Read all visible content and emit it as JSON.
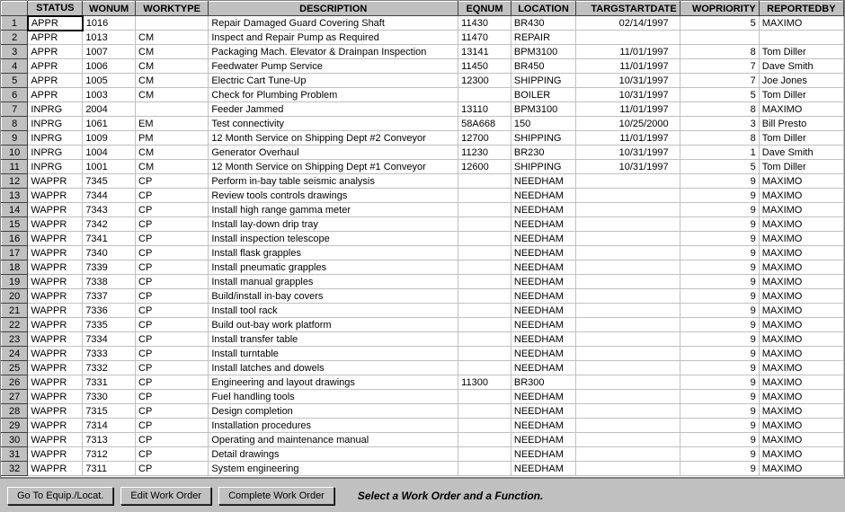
{
  "columns": [
    "STATUS",
    "WONUM",
    "WORKTYPE",
    "DESCRIPTION",
    "EQNUM",
    "LOCATION",
    "TARGSTARTDATE",
    "WOPRIORITY",
    "REPORTEDBY"
  ],
  "rows": [
    {
      "n": 1,
      "status": "APPR",
      "wonum": "1016",
      "worktype": "",
      "desc": "Repair Damaged Guard Covering Shaft",
      "eqnum": "11430",
      "location": "BR430",
      "targstart": "02/14/1997",
      "wopri": "5",
      "repby": "MAXIMO"
    },
    {
      "n": 2,
      "status": "APPR",
      "wonum": "1013",
      "worktype": "CM",
      "desc": "Inspect and Repair Pump as Required",
      "eqnum": "11470",
      "location": "REPAIR",
      "targstart": "",
      "wopri": "",
      "repby": ""
    },
    {
      "n": 3,
      "status": "APPR",
      "wonum": "1007",
      "worktype": "CM",
      "desc": "Packaging Mach. Elevator & Drainpan Inspection",
      "eqnum": "13141",
      "location": "BPM3100",
      "targstart": "11/01/1997",
      "wopri": "8",
      "repby": "Tom Diller"
    },
    {
      "n": 4,
      "status": "APPR",
      "wonum": "1006",
      "worktype": "CM",
      "desc": "Feedwater Pump Service",
      "eqnum": "11450",
      "location": "BR450",
      "targstart": "11/01/1997",
      "wopri": "7",
      "repby": "Dave Smith"
    },
    {
      "n": 5,
      "status": "APPR",
      "wonum": "1005",
      "worktype": "CM",
      "desc": "Electric Cart Tune-Up",
      "eqnum": "12300",
      "location": "SHIPPING",
      "targstart": "10/31/1997",
      "wopri": "7",
      "repby": "Joe Jones"
    },
    {
      "n": 6,
      "status": "APPR",
      "wonum": "1003",
      "worktype": "CM",
      "desc": "Check for Plumbing Problem",
      "eqnum": "",
      "location": "BOILER",
      "targstart": "10/31/1997",
      "wopri": "5",
      "repby": "Tom Diller"
    },
    {
      "n": 7,
      "status": "INPRG",
      "wonum": "2004",
      "worktype": "",
      "desc": "Feeder Jammed",
      "eqnum": "13110",
      "location": "BPM3100",
      "targstart": "11/01/1997",
      "wopri": "8",
      "repby": "MAXIMO"
    },
    {
      "n": 8,
      "status": "INPRG",
      "wonum": "1061",
      "worktype": "EM",
      "desc": "Test connectivity",
      "eqnum": "58A668",
      "location": "150",
      "targstart": "10/25/2000",
      "wopri": "3",
      "repby": "Bill Presto"
    },
    {
      "n": 9,
      "status": "INPRG",
      "wonum": "1009",
      "worktype": "PM",
      "desc": "12 Month Service on Shipping Dept #2 Conveyor",
      "eqnum": "12700",
      "location": "SHIPPING",
      "targstart": "11/01/1997",
      "wopri": "8",
      "repby": "Tom Diller"
    },
    {
      "n": 10,
      "status": "INPRG",
      "wonum": "1004",
      "worktype": "CM",
      "desc": "Generator Overhaul",
      "eqnum": "11230",
      "location": "BR230",
      "targstart": "10/31/1997",
      "wopri": "1",
      "repby": "Dave Smith"
    },
    {
      "n": 11,
      "status": "INPRG",
      "wonum": "1001",
      "worktype": "CM",
      "desc": "12 Month Service on Shipping Dept #1 Conveyor",
      "eqnum": "12600",
      "location": "SHIPPING",
      "targstart": "10/31/1997",
      "wopri": "5",
      "repby": "Tom Diller"
    },
    {
      "n": 12,
      "status": "WAPPR",
      "wonum": "7345",
      "worktype": "CP",
      "desc": "Perform in-bay table seismic analysis",
      "eqnum": "",
      "location": "NEEDHAM",
      "targstart": "",
      "wopri": "9",
      "repby": "MAXIMO"
    },
    {
      "n": 13,
      "status": "WAPPR",
      "wonum": "7344",
      "worktype": "CP",
      "desc": "Review tools controls drawings",
      "eqnum": "",
      "location": "NEEDHAM",
      "targstart": "",
      "wopri": "9",
      "repby": "MAXIMO"
    },
    {
      "n": 14,
      "status": "WAPPR",
      "wonum": "7343",
      "worktype": "CP",
      "desc": "Install high range gamma meter",
      "eqnum": "",
      "location": "NEEDHAM",
      "targstart": "",
      "wopri": "9",
      "repby": "MAXIMO"
    },
    {
      "n": 15,
      "status": "WAPPR",
      "wonum": "7342",
      "worktype": "CP",
      "desc": "Install lay-down drip tray",
      "eqnum": "",
      "location": "NEEDHAM",
      "targstart": "",
      "wopri": "9",
      "repby": "MAXIMO"
    },
    {
      "n": 16,
      "status": "WAPPR",
      "wonum": "7341",
      "worktype": "CP",
      "desc": "Install inspection telescope",
      "eqnum": "",
      "location": "NEEDHAM",
      "targstart": "",
      "wopri": "9",
      "repby": "MAXIMO"
    },
    {
      "n": 17,
      "status": "WAPPR",
      "wonum": "7340",
      "worktype": "CP",
      "desc": "Install flask grapples",
      "eqnum": "",
      "location": "NEEDHAM",
      "targstart": "",
      "wopri": "9",
      "repby": "MAXIMO"
    },
    {
      "n": 18,
      "status": "WAPPR",
      "wonum": "7339",
      "worktype": "CP",
      "desc": "Install pneumatic grapples",
      "eqnum": "",
      "location": "NEEDHAM",
      "targstart": "",
      "wopri": "9",
      "repby": "MAXIMO"
    },
    {
      "n": 19,
      "status": "WAPPR",
      "wonum": "7338",
      "worktype": "CP",
      "desc": "Install manual grapples",
      "eqnum": "",
      "location": "NEEDHAM",
      "targstart": "",
      "wopri": "9",
      "repby": "MAXIMO"
    },
    {
      "n": 20,
      "status": "WAPPR",
      "wonum": "7337",
      "worktype": "CP",
      "desc": "Build/install in-bay covers",
      "eqnum": "",
      "location": "NEEDHAM",
      "targstart": "",
      "wopri": "9",
      "repby": "MAXIMO"
    },
    {
      "n": 21,
      "status": "WAPPR",
      "wonum": "7336",
      "worktype": "CP",
      "desc": "Install tool rack",
      "eqnum": "",
      "location": "NEEDHAM",
      "targstart": "",
      "wopri": "9",
      "repby": "MAXIMO"
    },
    {
      "n": 22,
      "status": "WAPPR",
      "wonum": "7335",
      "worktype": "CP",
      "desc": "Build out-bay work platform",
      "eqnum": "",
      "location": "NEEDHAM",
      "targstart": "",
      "wopri": "9",
      "repby": "MAXIMO"
    },
    {
      "n": 23,
      "status": "WAPPR",
      "wonum": "7334",
      "worktype": "CP",
      "desc": "Install transfer table",
      "eqnum": "",
      "location": "NEEDHAM",
      "targstart": "",
      "wopri": "9",
      "repby": "MAXIMO"
    },
    {
      "n": 24,
      "status": "WAPPR",
      "wonum": "7333",
      "worktype": "CP",
      "desc": "Install turntable",
      "eqnum": "",
      "location": "NEEDHAM",
      "targstart": "",
      "wopri": "9",
      "repby": "MAXIMO"
    },
    {
      "n": 25,
      "status": "WAPPR",
      "wonum": "7332",
      "worktype": "CP",
      "desc": "Install latches and dowels",
      "eqnum": "",
      "location": "NEEDHAM",
      "targstart": "",
      "wopri": "9",
      "repby": "MAXIMO"
    },
    {
      "n": 26,
      "status": "WAPPR",
      "wonum": "7331",
      "worktype": "CP",
      "desc": "Engineering and layout drawings",
      "eqnum": "11300",
      "location": "BR300",
      "targstart": "",
      "wopri": "9",
      "repby": "MAXIMO"
    },
    {
      "n": 27,
      "status": "WAPPR",
      "wonum": "7330",
      "worktype": "CP",
      "desc": "Fuel handling tools",
      "eqnum": "",
      "location": "NEEDHAM",
      "targstart": "",
      "wopri": "9",
      "repby": "MAXIMO"
    },
    {
      "n": 28,
      "status": "WAPPR",
      "wonum": "7315",
      "worktype": "CP",
      "desc": "Design completion",
      "eqnum": "",
      "location": "NEEDHAM",
      "targstart": "",
      "wopri": "9",
      "repby": "MAXIMO"
    },
    {
      "n": 29,
      "status": "WAPPR",
      "wonum": "7314",
      "worktype": "CP",
      "desc": "Installation procedures",
      "eqnum": "",
      "location": "NEEDHAM",
      "targstart": "",
      "wopri": "9",
      "repby": "MAXIMO"
    },
    {
      "n": 30,
      "status": "WAPPR",
      "wonum": "7313",
      "worktype": "CP",
      "desc": "Operating and maintenance manual",
      "eqnum": "",
      "location": "NEEDHAM",
      "targstart": "",
      "wopri": "9",
      "repby": "MAXIMO"
    },
    {
      "n": 31,
      "status": "WAPPR",
      "wonum": "7312",
      "worktype": "CP",
      "desc": "Detail drawings",
      "eqnum": "",
      "location": "NEEDHAM",
      "targstart": "",
      "wopri": "9",
      "repby": "MAXIMO"
    },
    {
      "n": 32,
      "status": "WAPPR",
      "wonum": "7311",
      "worktype": "CP",
      "desc": "System engineering",
      "eqnum": "",
      "location": "NEEDHAM",
      "targstart": "",
      "wopri": "9",
      "repby": "MAXIMO"
    }
  ],
  "selected_row": 1,
  "buttons": {
    "goto": "Go To Equip./Locat.",
    "edit": "Edit Work Order",
    "complete": "Complete Work Order"
  },
  "status_message": "Select a Work Order and a Function."
}
